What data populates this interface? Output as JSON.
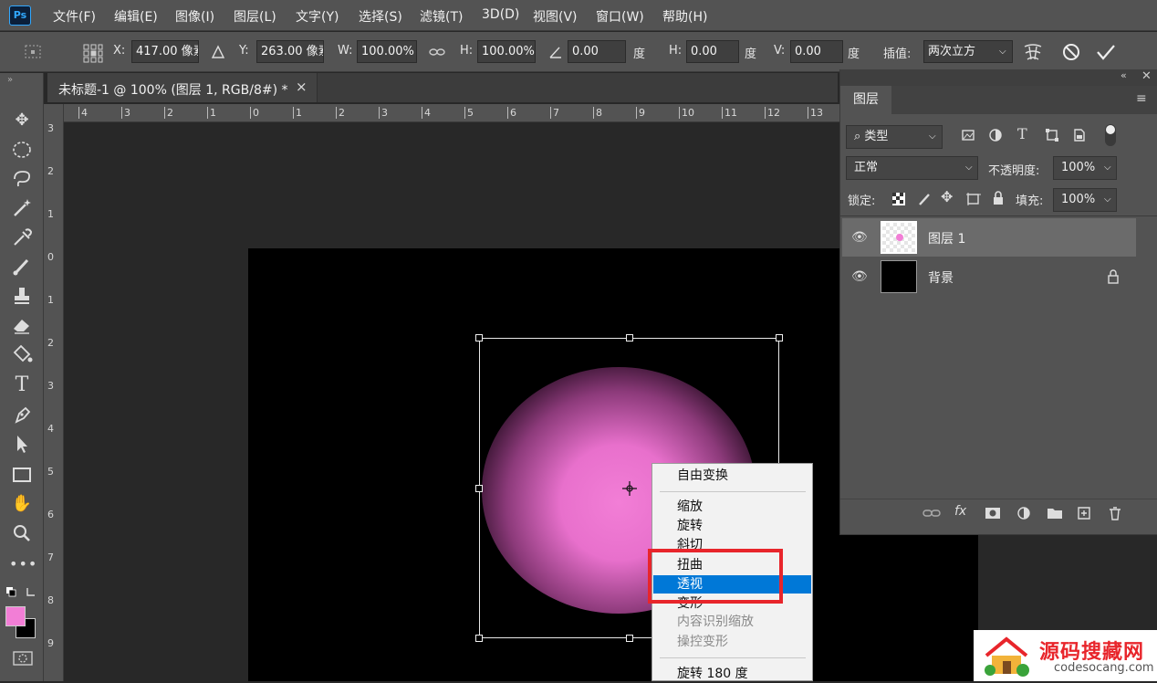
{
  "app": {
    "logo": "Ps"
  },
  "menubar": {
    "items": [
      "文件(F)",
      "编辑(E)",
      "图像(I)",
      "图层(L)",
      "文字(Y)",
      "选择(S)",
      "滤镜(T)",
      "3D(D)",
      "视图(V)",
      "窗口(W)",
      "帮助(H)"
    ]
  },
  "options": {
    "x_label": "X:",
    "x_value": "417.00 像素",
    "y_label": "Y:",
    "y_value": "263.00 像素",
    "w_label": "W:",
    "w_value": "100.00%",
    "h_label": "H:",
    "h_value": "100.00%",
    "angle_value": "0.00",
    "deg1": "度",
    "hskew_label": "H:",
    "hskew_value": "0.00",
    "deg2": "度",
    "vskew_label": "V:",
    "vskew_value": "0.00",
    "deg3": "度",
    "interp_label": "插值:",
    "interp_value": "两次立方"
  },
  "document": {
    "tab_title": "未标题-1 @ 100% (图层 1, RGB/8#) *",
    "close": "×"
  },
  "rulers": {
    "top": [
      "4",
      "3",
      "2",
      "1",
      "0",
      "1",
      "2",
      "3",
      "4",
      "5",
      "6",
      "7",
      "8",
      "9",
      "10",
      "11",
      "12",
      "13"
    ],
    "left": [
      "3",
      "2",
      "1",
      "0",
      "1",
      "2",
      "3",
      "4",
      "5",
      "6",
      "7",
      "8",
      "9"
    ]
  },
  "colors": {
    "foreground": "#f27ed6",
    "background": "#000000",
    "highlight": "#0078d7",
    "annotation": "#e8252b"
  },
  "context_menu": {
    "items": [
      "自由变换",
      "缩放",
      "旋转",
      "斜切",
      "扭曲",
      "透视",
      "变形",
      "内容识别缩放",
      "操控变形",
      "旋转 180 度"
    ],
    "selected": "透视",
    "disabled": [
      "内容识别缩放",
      "操控变形"
    ]
  },
  "layers_panel": {
    "tab": "图层",
    "filter_kind": "类型",
    "blend_mode": "正常",
    "opacity_label": "不透明度:",
    "opacity_value": "100%",
    "lock_label": "锁定:",
    "fill_label": "填充:",
    "fill_value": "100%",
    "layers": [
      {
        "name": "图层 1",
        "selected": true
      },
      {
        "name": "背景",
        "locked": true
      }
    ],
    "footer_fx": "fx"
  },
  "watermark": {
    "title": "源码搜藏网",
    "url": "codesocang.com"
  }
}
